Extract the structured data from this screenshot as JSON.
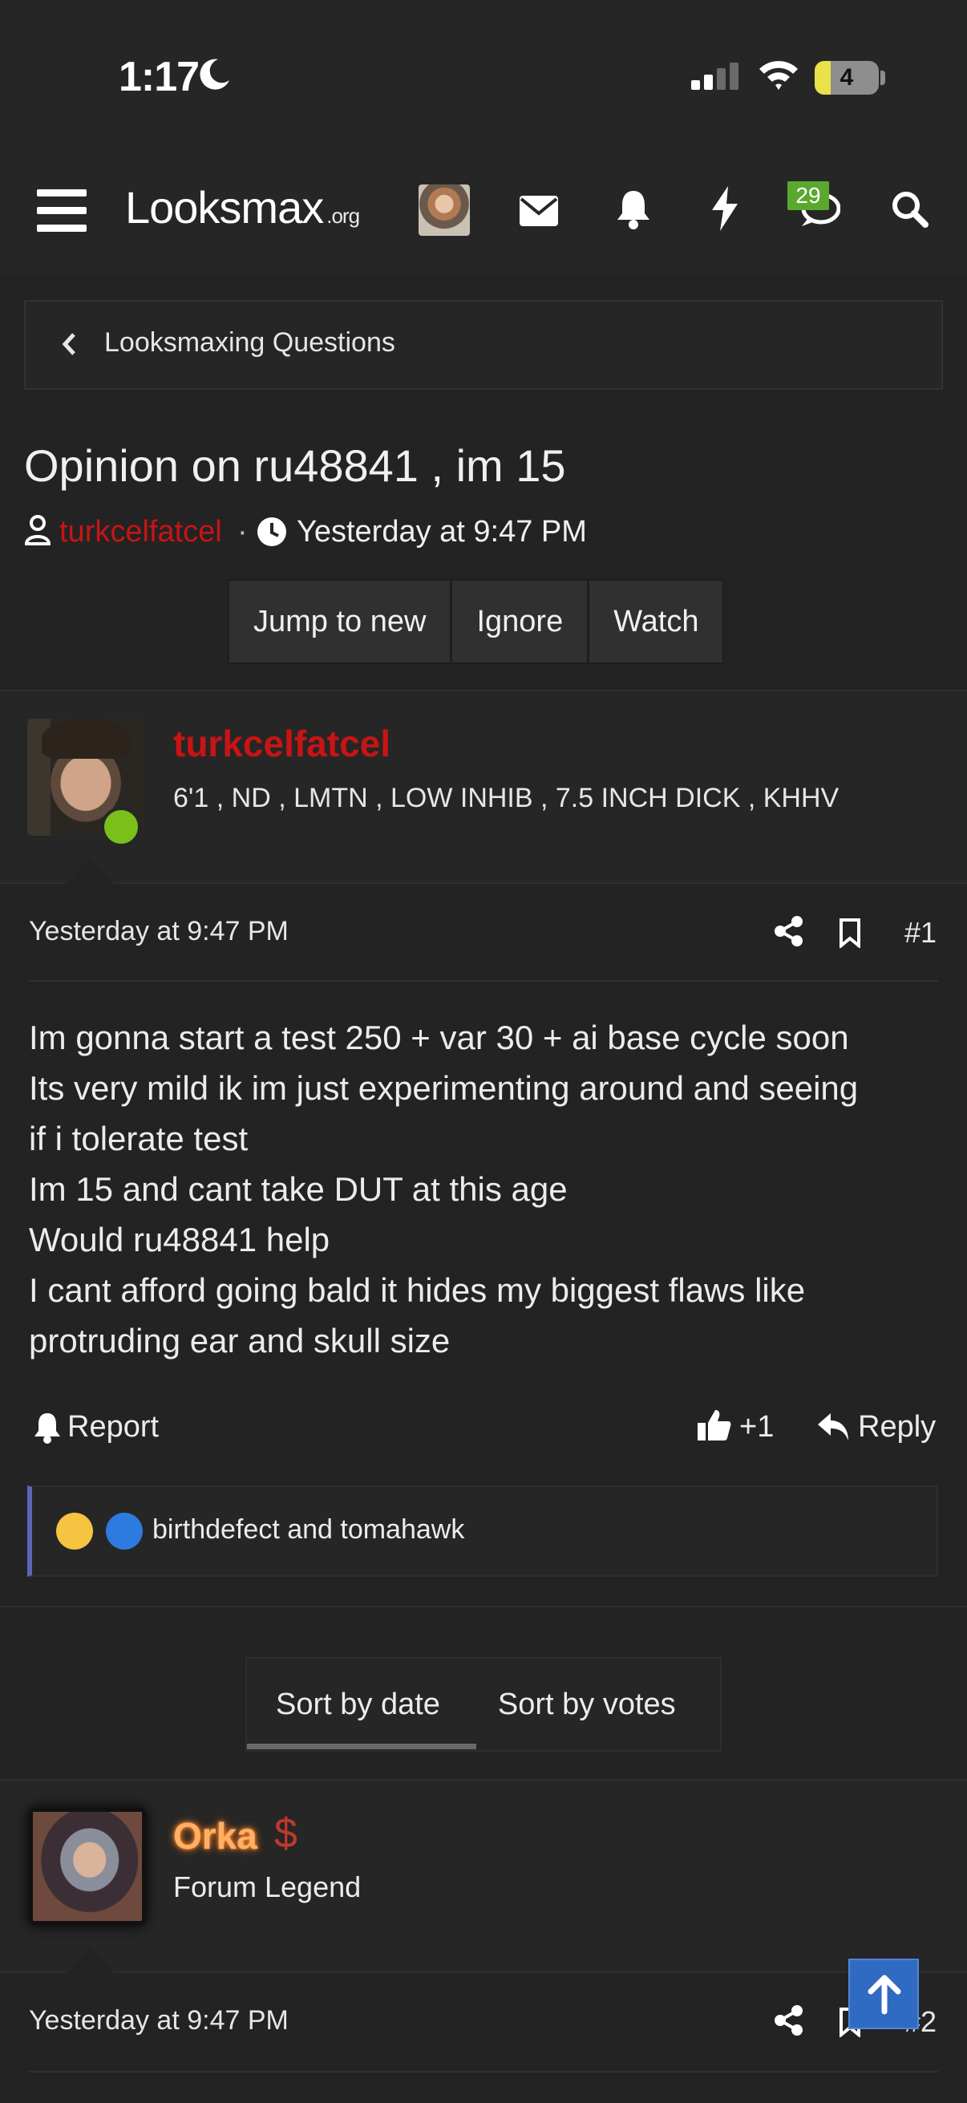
{
  "status_bar": {
    "time": "1:17",
    "battery_level": "4"
  },
  "navbar": {
    "logo_text": "Looksmax",
    "logo_tld": ".org",
    "chat_badge": "29"
  },
  "breadcrumb": {
    "label": "Looksmaxing Questions"
  },
  "thread": {
    "title": "Opinion on ru48841 , im 15",
    "author": "turkcelfatcel",
    "separator": "·",
    "date": "Yesterday at 9:47 PM",
    "actions": {
      "jump_to_new": "Jump to new",
      "ignore": "Ignore",
      "watch": "Watch"
    }
  },
  "post1": {
    "username": "turkcelfatcel",
    "user_title": "6'1 , ND , LMTN , LOW INHIB , 7.5 INCH DICK , KHHV",
    "date": "Yesterday at 9:47 PM",
    "number": "#1",
    "body_lines": [
      "Im gonna start a test 250 + var 30 + ai base cycle soon",
      "Its very mild ik im just experimenting around and seeing",
      "if i tolerate test",
      "Im 15 and cant take DUT at this age",
      "Would ru48841 help",
      "I cant afford going bald it hides my biggest flaws like",
      "protruding ear and skull size"
    ],
    "report_label": "Report",
    "like_count": "+1",
    "reply_label": "Reply",
    "reactions_text": "birthdefect and tomahawk"
  },
  "sort": {
    "by_date": "Sort by date",
    "by_votes": "Sort by votes"
  },
  "post2": {
    "username": "Orka",
    "dollar_badge": "$",
    "user_title": "Forum Legend",
    "date": "Yesterday at 9:47 PM",
    "number": "#2"
  },
  "colors": {
    "background": "#232323",
    "username_red": "#c81414",
    "online_green": "#7bbf1a",
    "badge_green": "#5aa82e",
    "reaction_bar": "#5a66b8",
    "scroll_button": "#2f6ac3",
    "legend_orange": "#ffb066"
  },
  "icons": {
    "nav": [
      "menu-icon",
      "mail-icon",
      "bell-icon",
      "bolt-icon",
      "chat-icon",
      "search-icon"
    ],
    "post": [
      "share-icon",
      "bookmark-icon",
      "bell-icon",
      "thumbs-up-icon",
      "reply-arrow-icon"
    ]
  }
}
